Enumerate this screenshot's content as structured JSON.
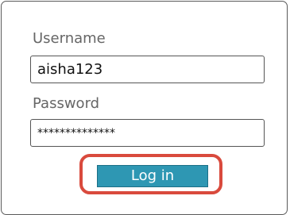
{
  "form": {
    "username_label": "Username",
    "username_value": "aisha123",
    "password_label": "Password",
    "password_value": "**************",
    "login_label": "Log in"
  },
  "colors": {
    "accent": "#2e97b3",
    "highlight": "#d94a3d"
  }
}
